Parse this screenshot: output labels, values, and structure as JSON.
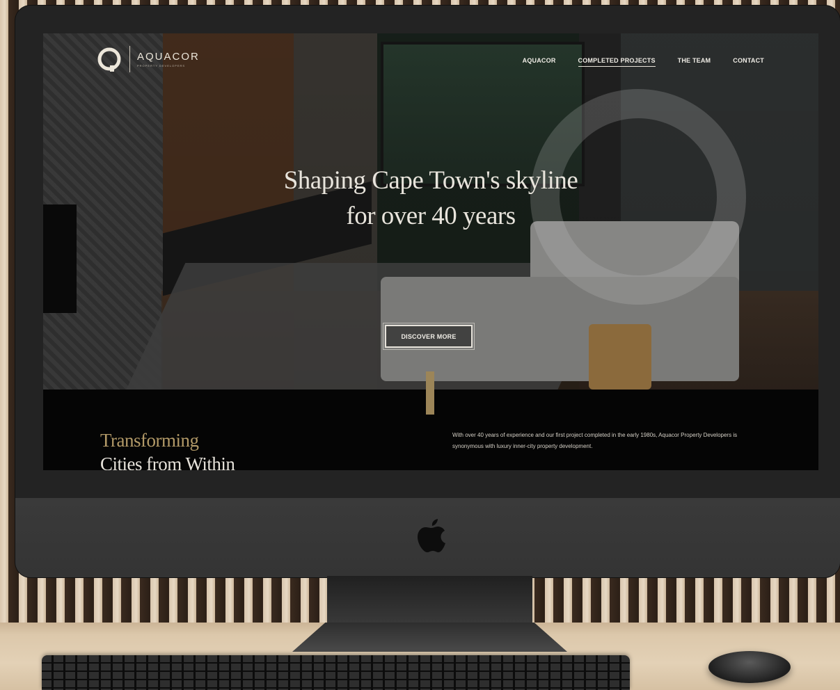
{
  "site": {
    "brand": {
      "name": "AQUACOR",
      "tagline": "PROPERTY DEVELOPERS",
      "mark": "Q"
    },
    "nav": {
      "items": [
        {
          "label": "AQUACOR",
          "active": false
        },
        {
          "label": "COMPLETED PROJECTS",
          "active": true
        },
        {
          "label": "THE TEAM",
          "active": false
        },
        {
          "label": "CONTACT",
          "active": false
        }
      ]
    },
    "hero": {
      "headline_line1": "Shaping Cape Town's skyline",
      "headline_line2": "for over 40 years",
      "cta_label": "DISCOVER MORE"
    },
    "intro": {
      "title_line1": "Transforming",
      "title_line2": "Cities from Within",
      "body": "With over 40 years of experience and our first project completed in the early 1980s, Aquacor Property Developers is synonymous with luxury inner-city property development."
    }
  },
  "colors": {
    "accent_gold": "#b39a68",
    "hero_text": "#e8e4dc",
    "screen_bg": "#050505"
  },
  "icons": {
    "hardware_logo": "apple-logo-icon"
  }
}
